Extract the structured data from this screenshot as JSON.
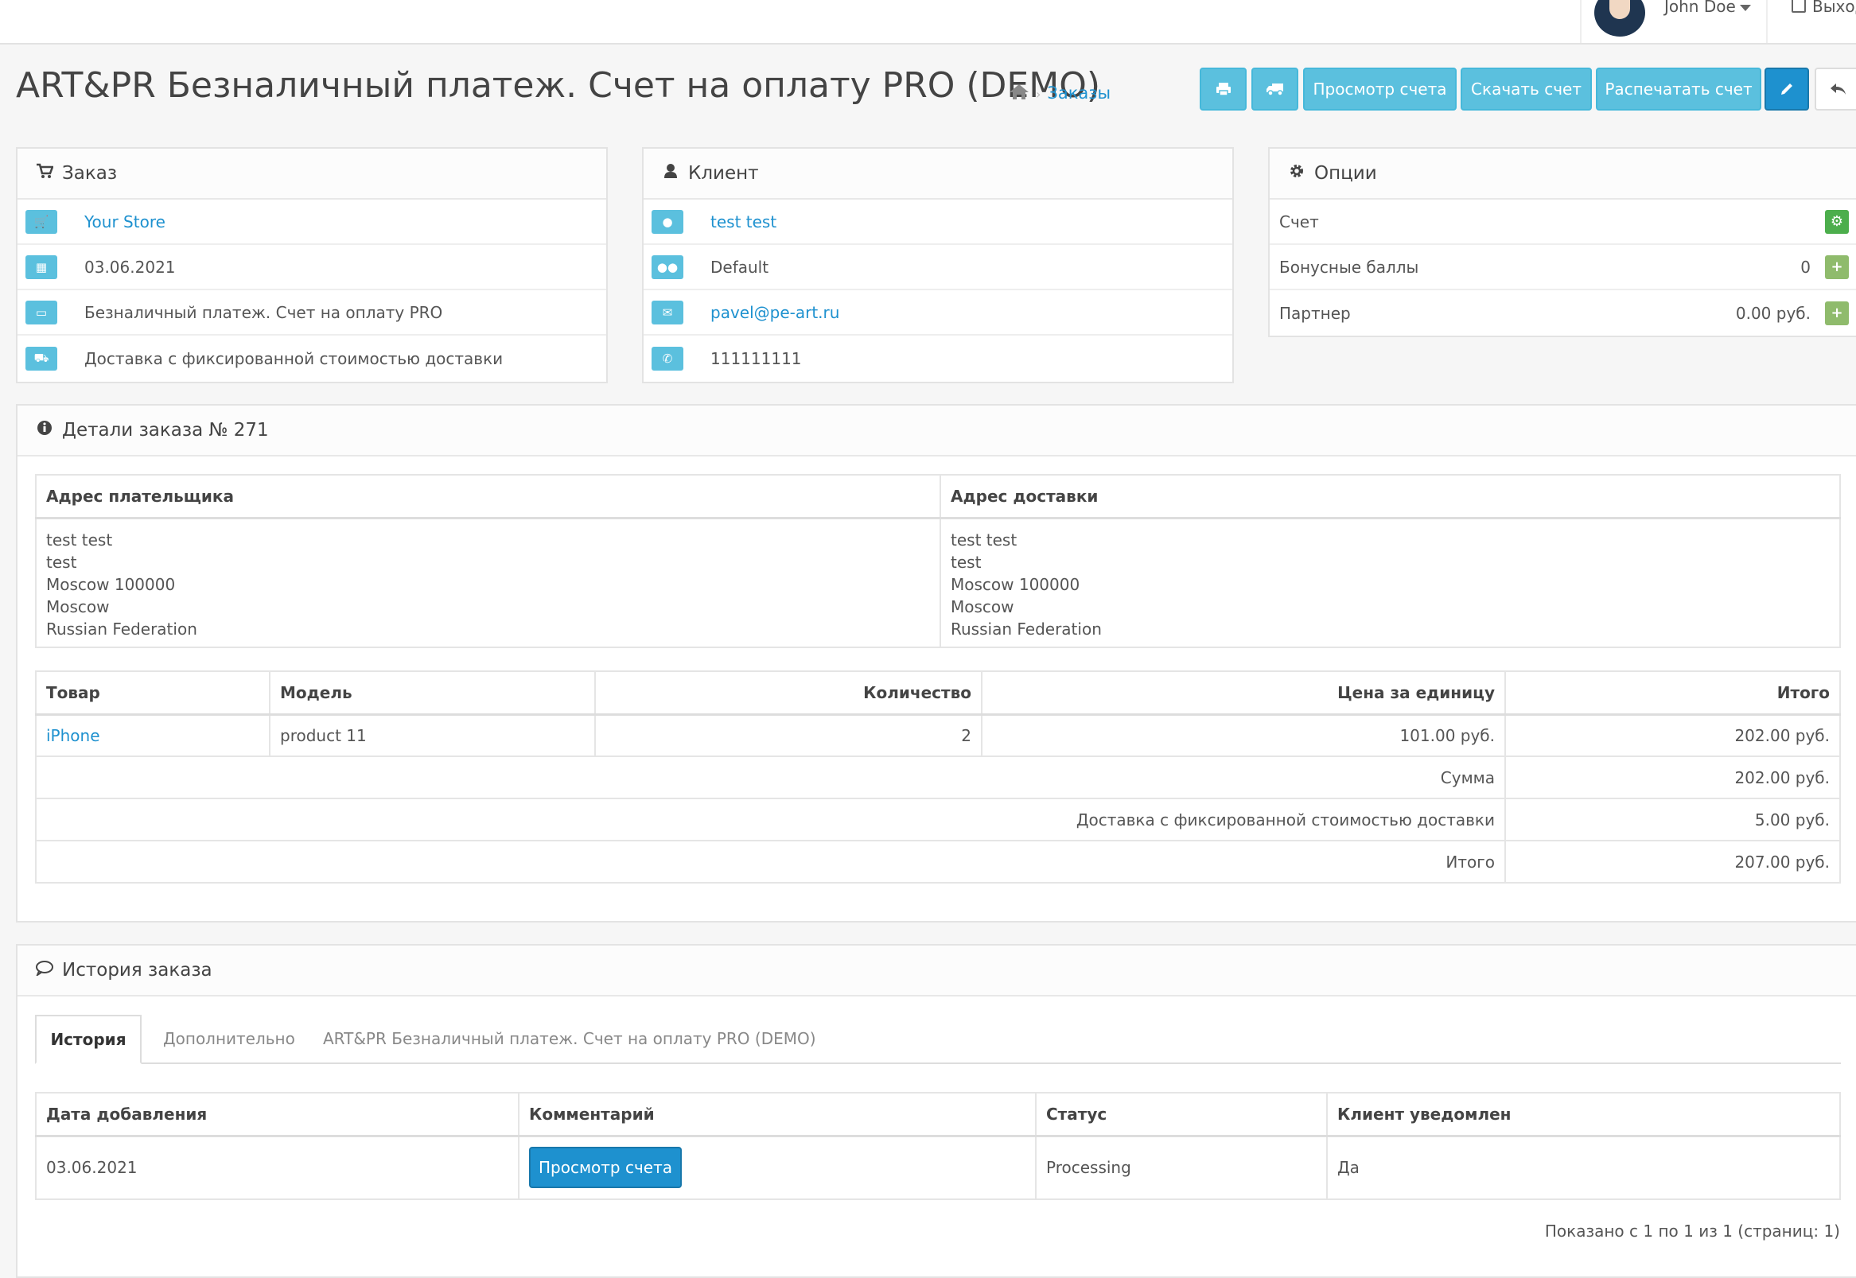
{
  "user": {
    "name": "John Doe",
    "logout": "Выход"
  },
  "header": {
    "title": "ART&PR Безналичный платеж. Счет на оплату PRO (DEMO)",
    "breadcrumb": "Заказы"
  },
  "toolbar": {
    "view_invoice": "Просмотр счета",
    "download_invoice": "Скачать счет",
    "print_invoice": "Распечатать счет"
  },
  "order_panel": {
    "title": "Заказ",
    "store": "Your Store",
    "date": "03.06.2021",
    "payment": "Безналичный платеж. Счет на оплату PRO",
    "shipping": "Доставка с фиксированной стоимостью доставки"
  },
  "customer_panel": {
    "title": "Клиент",
    "name": "test test",
    "group": "Default",
    "email": "pavel@pe-art.ru",
    "phone": "111111111"
  },
  "options_panel": {
    "title": "Опции",
    "invoice_label": "Счет",
    "reward_label": "Бонусные баллы",
    "reward_value": "0",
    "affiliate_label": "Партнер",
    "affiliate_value": "0.00 руб."
  },
  "details": {
    "title": "Детали заказа № 271",
    "payment_address_header": "Адрес плательщика",
    "shipping_address_header": "Адрес доставки",
    "payment_address": [
      "test test",
      "test",
      "Moscow 100000",
      "Moscow",
      "Russian Federation"
    ],
    "shipping_address": [
      "test test",
      "test",
      "Moscow 100000",
      "Moscow",
      "Russian Federation"
    ],
    "columns": [
      "Товар",
      "Модель",
      "Количество",
      "Цена за единицу",
      "Итого"
    ],
    "product": {
      "name": "iPhone",
      "model": "product 11",
      "quantity": "2",
      "price": "101.00 руб.",
      "total": "202.00 руб."
    },
    "totals": [
      {
        "label": "Сумма",
        "value": "202.00 руб."
      },
      {
        "label": "Доставка с фиксированной стоимостью доставки",
        "value": "5.00 руб."
      },
      {
        "label": "Итого",
        "value": "207.00 руб."
      }
    ]
  },
  "history": {
    "title": "История заказа",
    "tabs": [
      "История",
      "Дополнительно",
      "ART&PR Безналичный платеж. Счет на оплату PRO (DEMO)"
    ],
    "columns": [
      "Дата добавления",
      "Комментарий",
      "Статус",
      "Клиент уведомлен"
    ],
    "row": {
      "date": "03.06.2021",
      "comment_button": "Просмотр счета",
      "status": "Processing",
      "notified": "Да"
    },
    "pagination": "Показано с 1 по 1 из 1 (страниц: 1)"
  },
  "colors": {
    "info": "#5bc0de",
    "primary": "#1e91cf",
    "success": "#8fbb6c"
  }
}
